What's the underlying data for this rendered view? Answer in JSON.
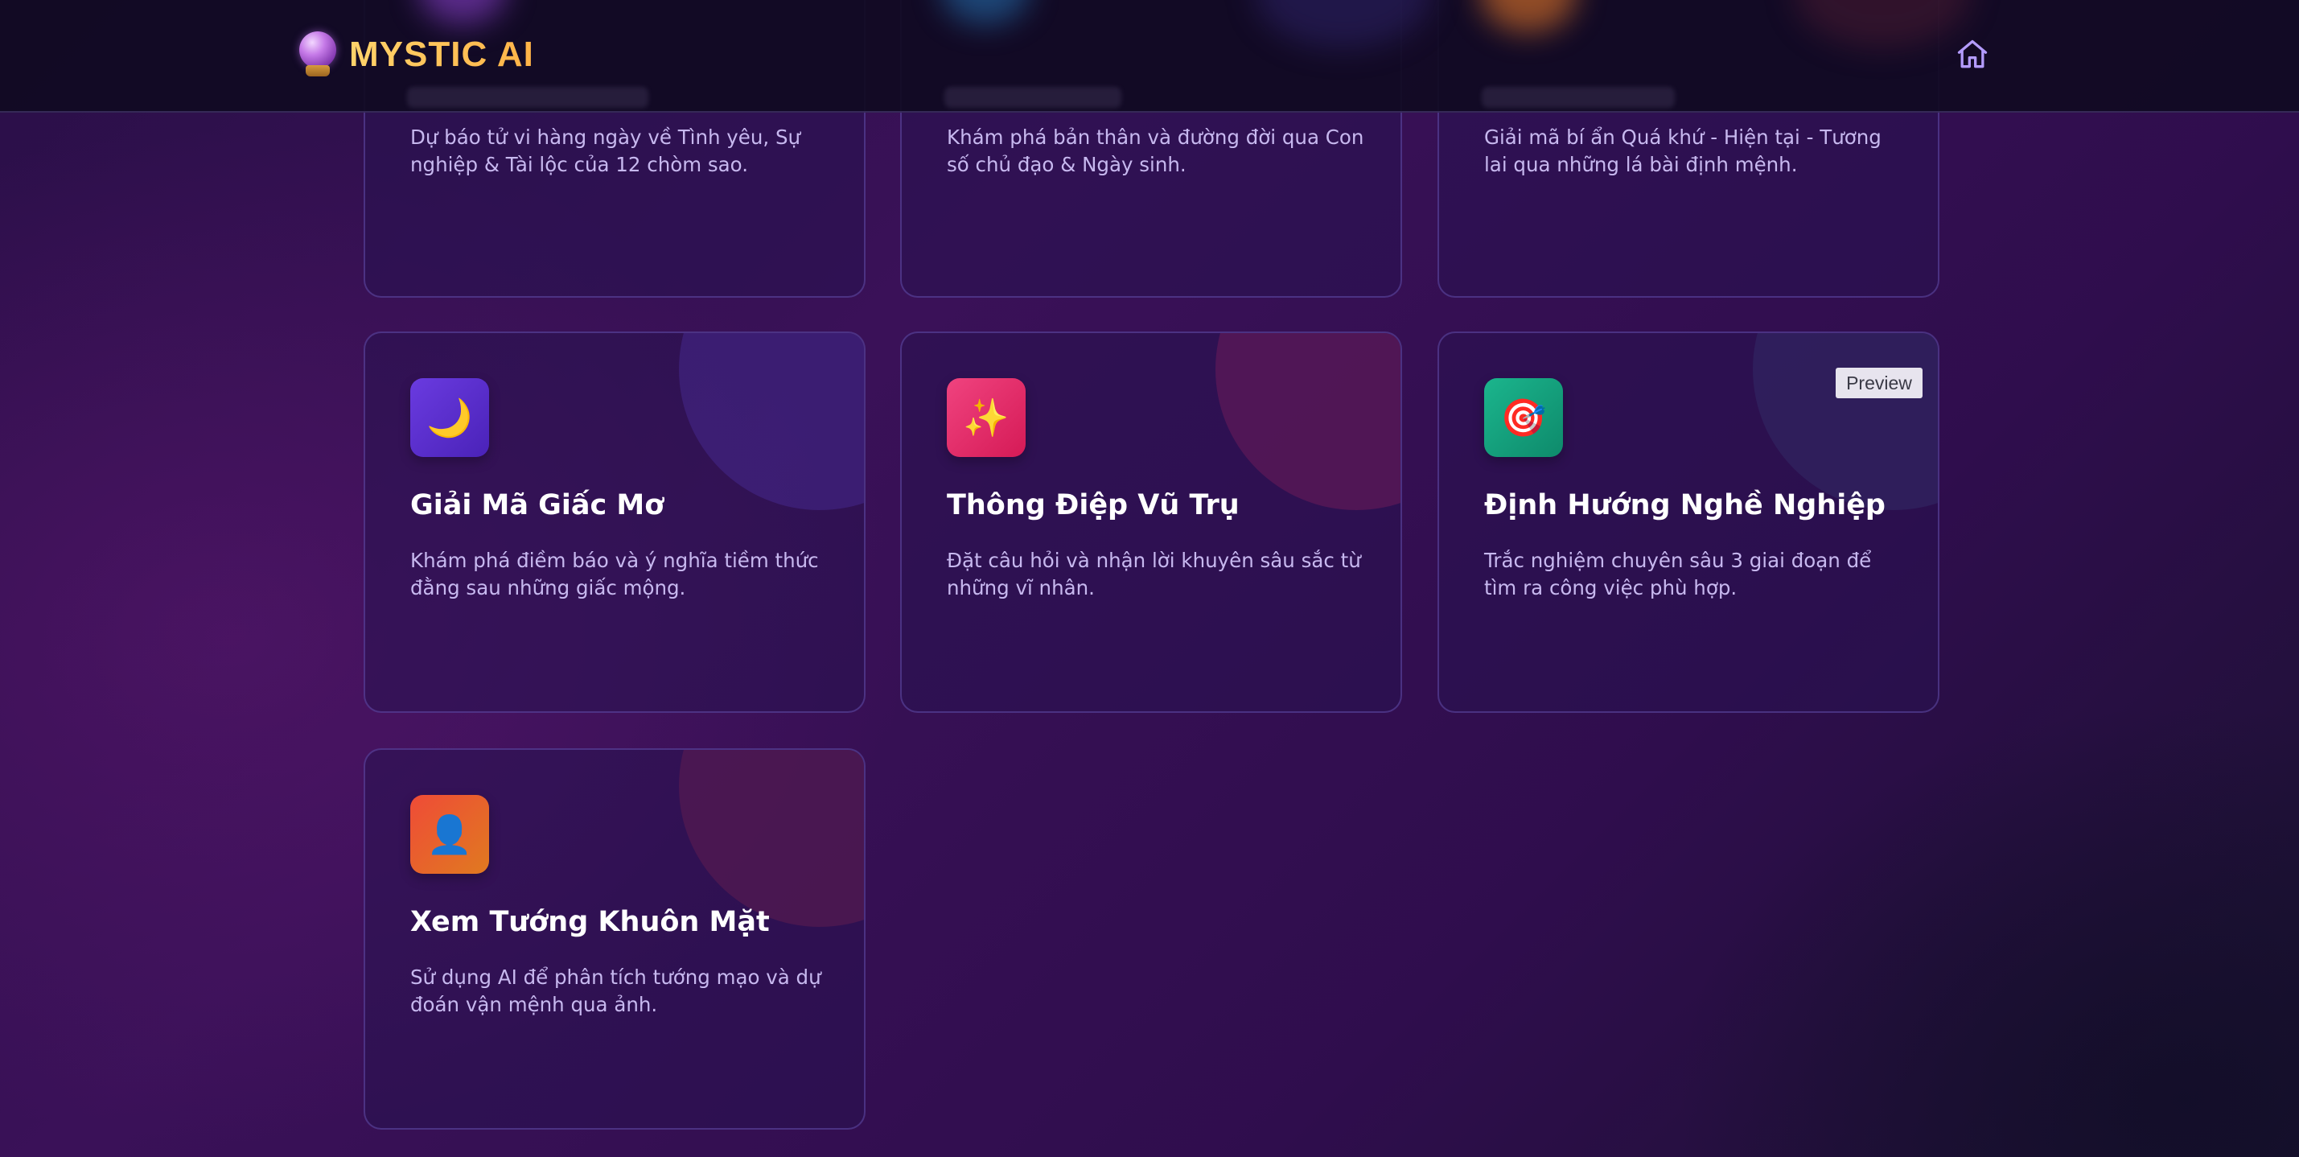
{
  "header": {
    "brand_name": "MYSTIC AI",
    "brand_icon": "crystal-ball-icon",
    "home_icon": "home-icon"
  },
  "cards_partial": [
    {
      "description": "Dự báo tử vi hàng ngày về Tình yêu, Sự nghiệp & Tài lộc của 12 chòm sao."
    },
    {
      "description": "Khám phá bản thân và đường đời qua Con số chủ đạo & Ngày sinh."
    },
    {
      "description": "Giải mã bí ẩn Quá khứ - Hiện tại - Tương lai qua những lá bài định mệnh."
    }
  ],
  "cards": [
    {
      "title": "Giải Mã Giấc Mơ",
      "description": "Khám phá điềm báo và ý nghĩa tiềm thức đằng sau những giấc mộng.",
      "icon": "crescent-moon-icon",
      "icon_glyph": "🌙",
      "tile_color": "#5b2fd0"
    },
    {
      "title": "Thông Điệp Vũ Trụ",
      "description": "Đặt câu hỏi và nhận lời khuyên sâu sắc từ những vĩ nhân.",
      "icon": "sparkles-icon",
      "icon_glyph": "✨",
      "tile_color": "#e8246a"
    },
    {
      "title": "Định Hướng Nghề Nghiệp",
      "description": "Trắc nghiệm chuyên sâu 3 giai đoạn để tìm ra công việc phù hợp.",
      "icon": "target-dart-icon",
      "icon_glyph": "🎯",
      "tile_color": "#129c7a",
      "badge": "Preview"
    },
    {
      "title": "Xem Tướng Khuôn Mặt",
      "description": "Sử dụng AI để phân tích tướng mạo và dự đoán vận mệnh qua ảnh.",
      "icon": "face-silhouette-icon",
      "icon_glyph": "👤",
      "tile_color": "#e8582c"
    }
  ]
}
